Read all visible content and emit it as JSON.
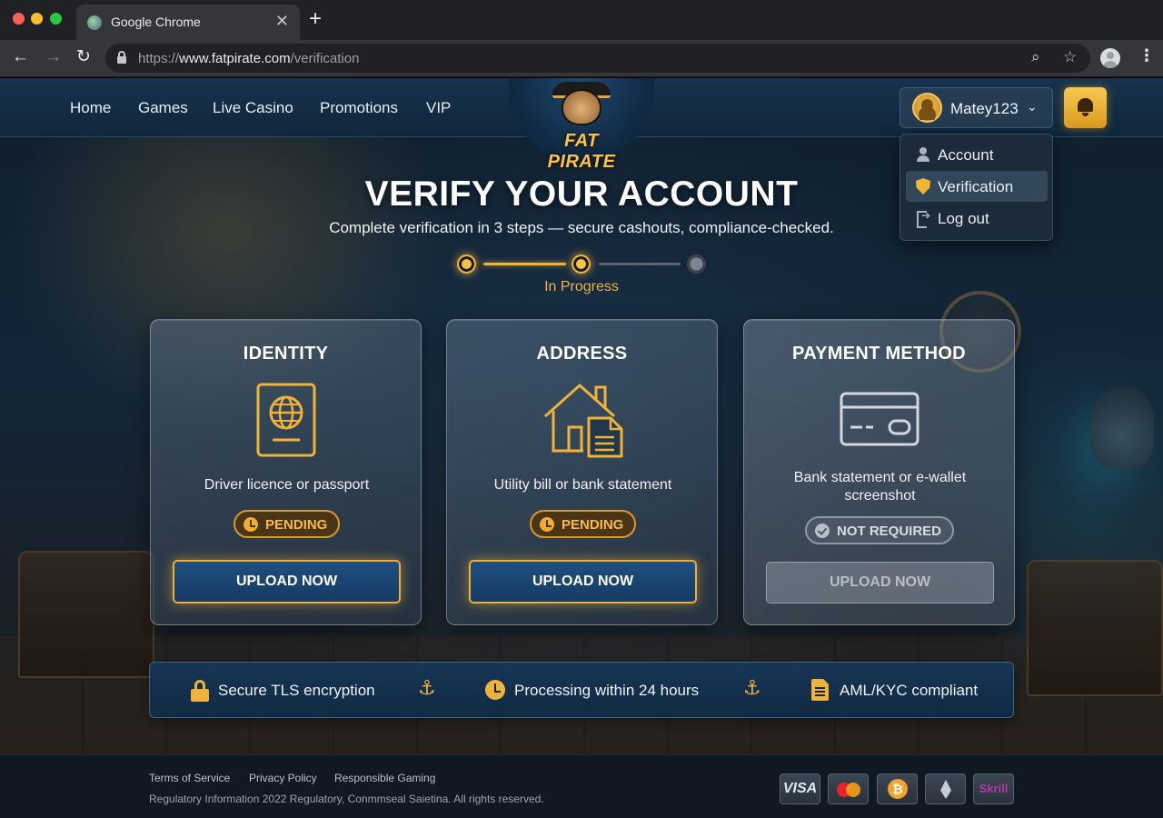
{
  "browser": {
    "tab_title": "Google Chrome",
    "url_prefix": "https://",
    "url_domain": "www.fatpirate.com",
    "url_path": "/verification"
  },
  "header": {
    "nav": [
      "Home",
      "Games",
      "Live Casino",
      "Promotions",
      "VIP"
    ],
    "logo_text": "FAT PIRATE",
    "username": "Matey123"
  },
  "user_menu": {
    "items": [
      {
        "label": "Account",
        "icon": "user-icon"
      },
      {
        "label": "Verification",
        "icon": "shield-check-icon",
        "active": true
      },
      {
        "label": "Log out",
        "icon": "logout-icon"
      }
    ]
  },
  "hero": {
    "title": "VERIFY YOUR ACCOUNT",
    "subtitle": "Complete verification in 3 steps — secure cashouts, compliance-checked.",
    "progress_label": "In Progress",
    "steps_done": 2,
    "steps_total": 3
  },
  "cards": [
    {
      "title": "IDENTITY",
      "desc": "Driver licence or passport",
      "status": "PENDING",
      "button": "UPLOAD NOW",
      "icon": "passport-icon",
      "enabled": true
    },
    {
      "title": "ADDRESS",
      "desc": "Utility bill or bank statement",
      "status": "PENDING",
      "button": "UPLOAD NOW",
      "icon": "house-document-icon",
      "enabled": true
    },
    {
      "title": "PAYMENT METHOD",
      "desc": "Bank statement or e-wallet screenshot",
      "status": "NOT REQUIRED",
      "button": "UPLOAD NOW",
      "icon": "credit-card-icon",
      "enabled": false
    }
  ],
  "trust": {
    "encryption": "Secure TLS encryption",
    "processing": "Processing within 24 hours",
    "compliance": "AML/KYC compliant"
  },
  "footer": {
    "links": [
      "Terms of Service",
      "Privacy Policy",
      "Responsible Gaming"
    ],
    "legal": "Regulatory Information 2022  Regulatory, Conmmseal Saietina. All rights reserved.",
    "payments": [
      "VISA",
      "Mastercard",
      "Bitcoin",
      "Ethereum",
      "Skrill"
    ],
    "skrill_label": "Skrill",
    "visa_label": "VISA"
  },
  "colors": {
    "accent_gold": "#f0b23a",
    "header_bg": "#17324d",
    "button_blue": "#1f4f80"
  }
}
